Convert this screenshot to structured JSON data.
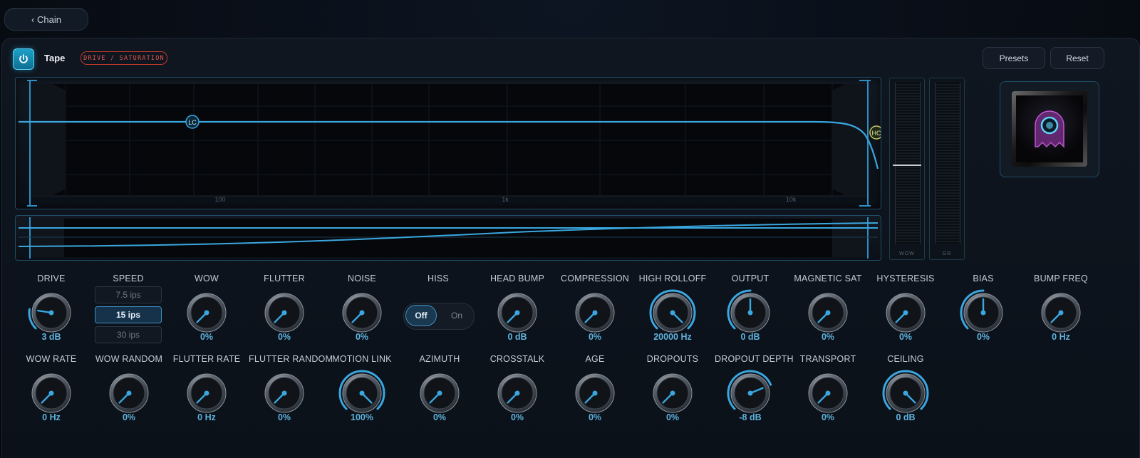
{
  "nav": {
    "back_label": "‹ Chain"
  },
  "header": {
    "title": "Tape",
    "badge": "DRIVE / SATURATION",
    "presets_label": "Presets",
    "reset_label": "Reset",
    "power_icon": "power-icon"
  },
  "eq": {
    "freq_labels": [
      "100",
      "1k",
      "10k"
    ],
    "low_handle": "LC",
    "high_handle": "HC"
  },
  "meters": [
    {
      "label": "WOW"
    },
    {
      "label": "GR"
    }
  ],
  "accent_color": "#3aa7e0",
  "knobs_row1": [
    {
      "label": "DRIVE",
      "value": "3 dB",
      "level": 0.2
    },
    {
      "label": "SPEED",
      "type": "selector"
    },
    {
      "label": "WOW",
      "value": "0%",
      "level": 0
    },
    {
      "label": "FLUTTER",
      "value": "0%",
      "level": 0
    },
    {
      "label": "NOISE",
      "value": "0%",
      "level": 0
    },
    {
      "label": "HISS",
      "type": "toggle"
    },
    {
      "label": "HEAD BUMP",
      "value": "0 dB",
      "level": 0
    },
    {
      "label": "COMPRESSION",
      "value": "0%",
      "level": 0
    },
    {
      "label": "HIGH ROLLOFF",
      "value": "20000 Hz",
      "level": 1
    },
    {
      "label": "OUTPUT",
      "value": "0 dB",
      "level": 0.5
    },
    {
      "label": "MAGNETIC SAT",
      "value": "0%",
      "level": 0
    },
    {
      "label": "HYSTERESIS",
      "value": "0%",
      "level": 0
    },
    {
      "label": "BIAS",
      "value": "0%",
      "level": 0.5
    },
    {
      "label": "BUMP FREQ",
      "value": "0 Hz",
      "level": 0
    }
  ],
  "knobs_row2": [
    {
      "label": "WOW RATE",
      "value": "0 Hz",
      "level": 0
    },
    {
      "label": "WOW RANDOM",
      "value": "0%",
      "level": 0
    },
    {
      "label": "FLUTTER RATE",
      "value": "0 Hz",
      "level": 0
    },
    {
      "label": "FLUTTER RANDOM",
      "value": "0%",
      "level": 0
    },
    {
      "label": "MOTION LINK",
      "value": "100%",
      "level": 1
    },
    {
      "label": "AZIMUTH",
      "value": "0%",
      "level": 0
    },
    {
      "label": "CROSSTALK",
      "value": "0%",
      "level": 0
    },
    {
      "label": "AGE",
      "value": "0%",
      "level": 0
    },
    {
      "label": "DROPOUTS",
      "value": "0%",
      "level": 0
    },
    {
      "label": "DROPOUT DEPTH",
      "value": "-8 dB",
      "level": 0.75
    },
    {
      "label": "TRANSPORT",
      "value": "0%",
      "level": 0
    },
    {
      "label": "CEILING",
      "value": "0 dB",
      "level": 1
    }
  ],
  "speed": {
    "options": [
      "7.5 ips",
      "15 ips",
      "30 ips"
    ],
    "selected": "15 ips"
  },
  "hiss": {
    "off_label": "Off",
    "on_label": "On",
    "state": "Off"
  }
}
